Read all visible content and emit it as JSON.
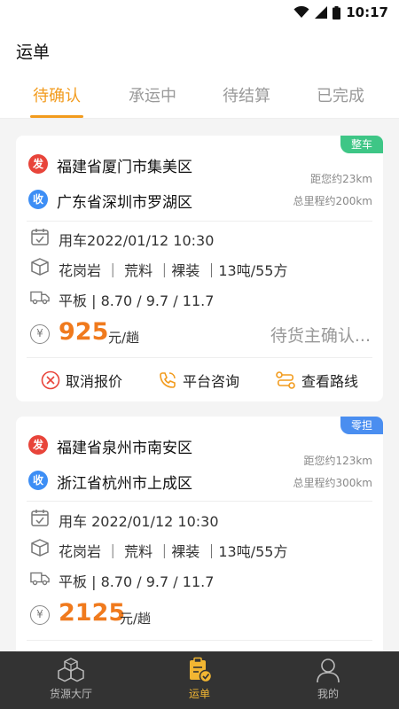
{
  "status_bar": {
    "time": "10:17"
  },
  "header": {
    "title": "运单",
    "tabs": [
      {
        "label": "待确认",
        "active": true
      },
      {
        "label": "承运中",
        "active": false
      },
      {
        "label": "待结算",
        "active": false
      },
      {
        "label": "已完成",
        "active": false
      }
    ]
  },
  "orders": [
    {
      "badge": "整车",
      "badge_color": "#3ec686",
      "from_tag": "发",
      "to_tag": "收",
      "from": "福建省厦门市集美区",
      "to": "广东省深圳市罗湖区",
      "distance": "距您约23km",
      "total_distance": "总里程约200km",
      "time": "用车2022/01/12 10:30",
      "cargo": "花岗岩 ｜ 荒料 ｜裸装 ｜13吨/55方",
      "vehicle": "平板 | 8.70 / 9.7 / 11.7",
      "price": "925",
      "price_unit": "元/趟",
      "status": "待货主确认...",
      "actions": {
        "cancel": "取消报价",
        "consult": "平台咨询",
        "route": "查看路线"
      }
    },
    {
      "badge": "零担",
      "badge_color": "#4a8ef0",
      "from_tag": "发",
      "to_tag": "收",
      "from": "福建省泉州市南安区",
      "to": "浙江省杭州市上成区",
      "distance": "距您约123km",
      "total_distance": "总里程约300km",
      "time": "用车 2022/01/12 10:30",
      "cargo": "花岗岩 ｜ 荒料 ｜裸装 ｜13吨/55方",
      "vehicle": "平板 | 8.70 / 9.7 / 11.7",
      "price": "2125",
      "price_unit": "元/趟"
    }
  ],
  "bottom_nav": [
    {
      "label": "货源大厅",
      "icon": "cubes-icon",
      "active": false
    },
    {
      "label": "运单",
      "icon": "clipboard-check-icon",
      "active": true
    },
    {
      "label": "我的",
      "icon": "person-icon",
      "active": false
    }
  ],
  "colors": {
    "accent": "#f29b1d",
    "price": "#f07a1d",
    "from_tag": "#e8443a",
    "to_tag": "#3d8ef5",
    "nav_bg": "#333333",
    "nav_active": "#f2b632"
  }
}
